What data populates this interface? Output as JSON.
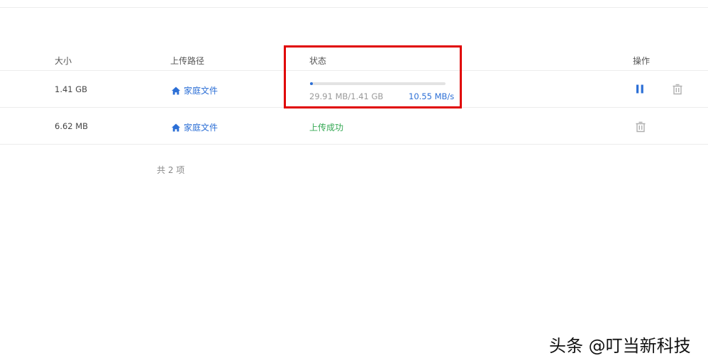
{
  "table": {
    "headers": {
      "size": "大小",
      "path": "上传路径",
      "status": "状态",
      "operations": "操作"
    },
    "rows": [
      {
        "size": "1.41 GB",
        "path": "家庭文件",
        "progress_fraction": 0.021,
        "progress_text": "29.91 MB/1.41 GB",
        "speed": "10.55 MB/s",
        "state": "uploading"
      },
      {
        "size": "6.62 MB",
        "path": "家庭文件",
        "status_text": "上传成功",
        "state": "done"
      }
    ]
  },
  "footer": {
    "total": "共 2 项"
  },
  "watermark": {
    "text": "头条 @叮当新科技"
  },
  "icons": {
    "home": "home-icon",
    "pause": "pause-icon",
    "trash": "trash-icon"
  },
  "colors": {
    "accent": "#2c6fd6",
    "success": "#34a853",
    "highlight": "#e00000",
    "muted": "#9a9a9a"
  }
}
